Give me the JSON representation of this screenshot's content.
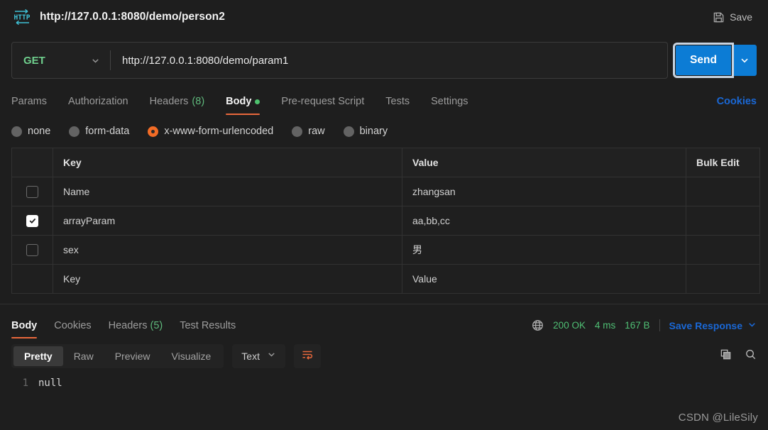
{
  "titlebar": {
    "icon": "http-icon",
    "title": "http://127.0.0.1:8080/demo/person2",
    "save_label": "Save",
    "save_icon": "floppy-disk-icon"
  },
  "request": {
    "method": "GET",
    "method_chevron_icon": "chevron-down-icon",
    "url": "http://127.0.0.1:8080/demo/param1",
    "send_label": "Send",
    "send_caret_icon": "chevron-down-icon",
    "tabs": [
      {
        "label": "Params",
        "count": "",
        "active": false,
        "dot": false
      },
      {
        "label": "Authorization",
        "count": "",
        "active": false,
        "dot": false
      },
      {
        "label": "Headers",
        "count": "(8)",
        "active": false,
        "dot": false
      },
      {
        "label": "Body",
        "count": "",
        "active": true,
        "dot": true
      },
      {
        "label": "Pre-request Script",
        "count": "",
        "active": false,
        "dot": false
      },
      {
        "label": "Tests",
        "count": "",
        "active": false,
        "dot": false
      },
      {
        "label": "Settings",
        "count": "",
        "active": false,
        "dot": false
      }
    ],
    "cookies_link": "Cookies",
    "body_types": [
      {
        "label": "none",
        "checked": false
      },
      {
        "label": "form-data",
        "checked": false
      },
      {
        "label": "x-www-form-urlencoded",
        "checked": true
      },
      {
        "label": "raw",
        "checked": false
      },
      {
        "label": "binary",
        "checked": false
      }
    ],
    "table": {
      "headers": {
        "key": "Key",
        "value": "Value",
        "bulk_edit": "Bulk Edit"
      },
      "rows": [
        {
          "checked": false,
          "key": "Name",
          "value": "zhangsan",
          "placeholder_row": false
        },
        {
          "checked": true,
          "key": "arrayParam",
          "value": "aa,bb,cc",
          "placeholder_row": false
        },
        {
          "checked": false,
          "key": "sex",
          "value": "男",
          "placeholder_row": false
        },
        {
          "checked": false,
          "key": "Key",
          "value": "Value",
          "placeholder_row": true
        }
      ]
    }
  },
  "response": {
    "tabs": [
      {
        "label": "Body",
        "count": "",
        "active": true
      },
      {
        "label": "Cookies",
        "count": "",
        "active": false
      },
      {
        "label": "Headers",
        "count": "(5)",
        "active": false
      },
      {
        "label": "Test Results",
        "count": "",
        "active": false
      }
    ],
    "globe_icon": "globe-icon",
    "status": "200 OK",
    "time": "4 ms",
    "size": "167 B",
    "save_response_label": "Save Response",
    "save_response_chevron_icon": "chevron-down-icon",
    "view_modes": [
      {
        "label": "Pretty",
        "active": true
      },
      {
        "label": "Raw",
        "active": false
      },
      {
        "label": "Preview",
        "active": false
      },
      {
        "label": "Visualize",
        "active": false
      }
    ],
    "format": "Text",
    "format_chevron_icon": "chevron-down-icon",
    "wrap_icon": "wrap-lines-icon",
    "copy_icon": "copy-icon",
    "search_icon": "search-icon",
    "code": {
      "line_numbers": [
        "1"
      ],
      "lines": [
        "null"
      ]
    }
  },
  "watermark": "CSDN @LileSily",
  "colors": {
    "accent_orange": "#e8683c",
    "send_blue": "#0c7cd5",
    "link_blue": "#1a68d6",
    "method_green": "#6fcf8d",
    "status_green": "#4fbf74",
    "radio_selected": "#f26c26",
    "background": "#1e1e1e"
  }
}
